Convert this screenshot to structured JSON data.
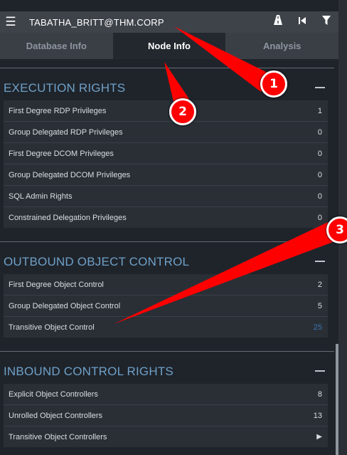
{
  "header": {
    "menu_icon": "hamburger-menu-icon",
    "node_name": "TABATHA_BRITT@THM.CORP",
    "icons": [
      "pathfinding-road-icon",
      "back-step-icon",
      "filter-icon"
    ]
  },
  "tabs": [
    {
      "label": "Database Info",
      "active": false
    },
    {
      "label": "Node Info",
      "active": true
    },
    {
      "label": "Analysis",
      "active": false
    }
  ],
  "execution_rights": {
    "title": "EXECUTION RIGHTS",
    "rows": [
      {
        "label": "First Degree RDP Privileges",
        "value": "1"
      },
      {
        "label": "Group Delegated RDP Privileges",
        "value": "0"
      },
      {
        "label": "First Degree DCOM Privileges",
        "value": "0"
      },
      {
        "label": "Group Delegated DCOM Privileges",
        "value": "0"
      },
      {
        "label": "SQL Admin Rights",
        "value": "0"
      },
      {
        "label": "Constrained Delegation Privileges",
        "value": "0"
      }
    ]
  },
  "outbound_object_control": {
    "title": "OUTBOUND OBJECT CONTROL",
    "rows": [
      {
        "label": "First Degree Object Control",
        "value": "2"
      },
      {
        "label": "Group Delegated Object Control",
        "value": "5"
      },
      {
        "label": "Transitive Object Control",
        "value": "25"
      }
    ]
  },
  "inbound_control_rights": {
    "title": "INBOUND CONTROL RIGHTS",
    "rows": [
      {
        "label": "Explicit Object Controllers",
        "value": "8"
      },
      {
        "label": "Unrolled Object Controllers",
        "value": "13"
      },
      {
        "label": "Transitive Object Controllers",
        "value": "▶"
      }
    ]
  },
  "annotations": {
    "markers": [
      "1",
      "2",
      "3"
    ],
    "color": "#ff0000"
  },
  "colors": {
    "section_title": "#6fa0c7",
    "link_value": "#3b73b0",
    "header_bg": "#3e434a"
  }
}
